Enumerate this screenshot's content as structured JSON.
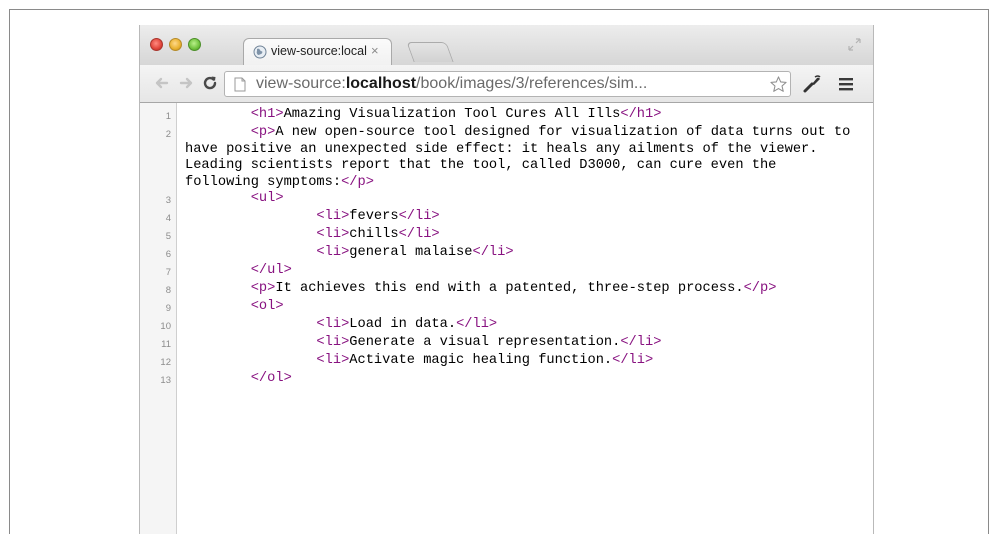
{
  "tab": {
    "title": "view-source:localhost/book",
    "close": "×"
  },
  "url": {
    "prefix": "view-source:",
    "host": "localhost",
    "path": "/book/images/3/references/sim..."
  },
  "icons": {
    "favicon": "globe-icon",
    "back": "back-arrow-icon",
    "forward": "forward-arrow-icon",
    "reload": "reload-icon",
    "page": "page-icon",
    "bookmark": "star-icon",
    "settings": "wrench-icon",
    "menu": "hamburger-menu-icon",
    "fullscreen": "fullscreen-icon"
  },
  "colors": {
    "tag": "#881280",
    "text": "#000000",
    "line_number": "#8c8c8c"
  },
  "source_lines": [
    {
      "n": "1",
      "indent": "        ",
      "segments": [
        {
          "t": "<h1>",
          "tag": true
        },
        {
          "t": "Amazing Visualization Tool Cures All Ills",
          "tag": false
        },
        {
          "t": "</h1>",
          "tag": true
        }
      ]
    },
    {
      "n": "2",
      "indent": "        ",
      "segments": [
        {
          "t": "<p>",
          "tag": true
        },
        {
          "t": "A new open-source tool designed for visualization of data turns out to have positive an unexpected side effect: it heals any ailments of the viewer. Leading scientists report that the tool, called D3000, can cure even the following symptoms:",
          "tag": false
        },
        {
          "t": "</p>",
          "tag": true
        }
      ]
    },
    {
      "n": "3",
      "indent": "        ",
      "segments": [
        {
          "t": "<ul>",
          "tag": true
        }
      ]
    },
    {
      "n": "4",
      "indent": "                ",
      "segments": [
        {
          "t": "<li>",
          "tag": true
        },
        {
          "t": "fevers",
          "tag": false
        },
        {
          "t": "</li>",
          "tag": true
        }
      ]
    },
    {
      "n": "5",
      "indent": "                ",
      "segments": [
        {
          "t": "<li>",
          "tag": true
        },
        {
          "t": "chills",
          "tag": false
        },
        {
          "t": "</li>",
          "tag": true
        }
      ]
    },
    {
      "n": "6",
      "indent": "                ",
      "segments": [
        {
          "t": "<li>",
          "tag": true
        },
        {
          "t": "general malaise",
          "tag": false
        },
        {
          "t": "</li>",
          "tag": true
        }
      ]
    },
    {
      "n": "7",
      "indent": "        ",
      "segments": [
        {
          "t": "</ul>",
          "tag": true
        }
      ]
    },
    {
      "n": "8",
      "indent": "        ",
      "segments": [
        {
          "t": "<p>",
          "tag": true
        },
        {
          "t": "It achieves this end with a patented, three-step process.",
          "tag": false
        },
        {
          "t": "</p>",
          "tag": true
        }
      ]
    },
    {
      "n": "9",
      "indent": "        ",
      "segments": [
        {
          "t": "<ol>",
          "tag": true
        }
      ]
    },
    {
      "n": "10",
      "indent": "                ",
      "segments": [
        {
          "t": "<li>",
          "tag": true
        },
        {
          "t": "Load in data.",
          "tag": false
        },
        {
          "t": "</li>",
          "tag": true
        }
      ]
    },
    {
      "n": "11",
      "indent": "                ",
      "segments": [
        {
          "t": "<li>",
          "tag": true
        },
        {
          "t": "Generate a visual representation.",
          "tag": false
        },
        {
          "t": "</li>",
          "tag": true
        }
      ]
    },
    {
      "n": "12",
      "indent": "                ",
      "segments": [
        {
          "t": "<li>",
          "tag": true
        },
        {
          "t": "Activate magic healing function.",
          "tag": false
        },
        {
          "t": "</li>",
          "tag": true
        }
      ]
    },
    {
      "n": "13",
      "indent": "        ",
      "segments": [
        {
          "t": "</ol>",
          "tag": true
        }
      ]
    }
  ]
}
